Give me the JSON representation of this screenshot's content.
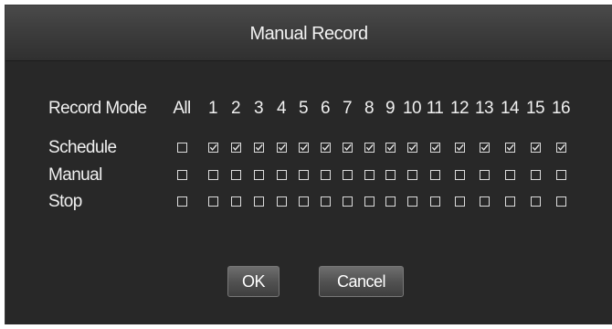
{
  "dialog": {
    "title": "Manual Record"
  },
  "grid": {
    "header_label": "Record Mode",
    "all_label": "All",
    "channels": [
      "1",
      "2",
      "3",
      "4",
      "5",
      "6",
      "7",
      "8",
      "9",
      "10",
      "11",
      "12",
      "13",
      "14",
      "15",
      "16"
    ],
    "rows": [
      {
        "label": "Schedule",
        "all": false,
        "channels": [
          true,
          true,
          true,
          true,
          true,
          true,
          true,
          true,
          true,
          true,
          true,
          true,
          true,
          true,
          true,
          true
        ]
      },
      {
        "label": "Manual",
        "all": false,
        "channels": [
          false,
          false,
          false,
          false,
          false,
          false,
          false,
          false,
          false,
          false,
          false,
          false,
          false,
          false,
          false,
          false
        ]
      },
      {
        "label": "Stop",
        "all": false,
        "channels": [
          false,
          false,
          false,
          false,
          false,
          false,
          false,
          false,
          false,
          false,
          false,
          false,
          false,
          false,
          false,
          false
        ]
      }
    ]
  },
  "buttons": {
    "ok_label": "OK",
    "cancel_label": "Cancel"
  },
  "icons": {
    "checkbox": "checkbox-icon",
    "checkmark": "checkmark-icon"
  }
}
